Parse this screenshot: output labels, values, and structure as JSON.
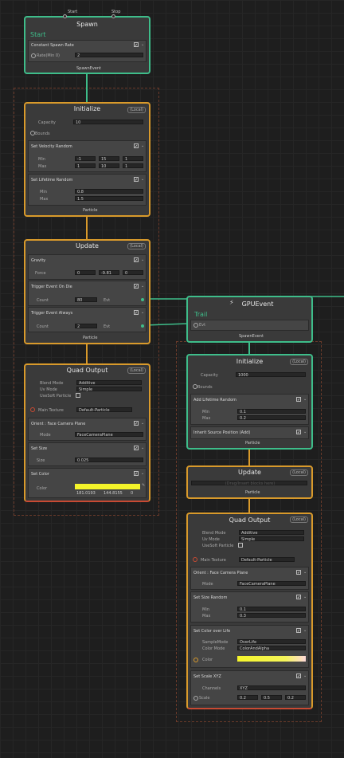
{
  "spawn": {
    "title": "Spawn",
    "start": "Start",
    "stop": "Stop",
    "sub": "Start",
    "block": "Constant Spawn Rate",
    "rate_label": "Rate(Min 0)",
    "rate": "2",
    "out": "SpawnEvent"
  },
  "init1": {
    "title": "Initialize",
    "tag": "(Local)",
    "capacity_label": "Capacity",
    "capacity": "10",
    "bounds": "Bounds",
    "vel_block": "Set Velocity Random",
    "min": "Min",
    "max": "Max",
    "vmin": [
      "-1",
      "15",
      "1"
    ],
    "vmax": [
      "1",
      "10",
      "1"
    ],
    "life_block": "Set Lifetime Random",
    "lmin": "0.8",
    "lmax": "1.5",
    "out": "Particle"
  },
  "update1": {
    "title": "Update",
    "tag": "(Local)",
    "gravity": "Gravity",
    "force": "Force",
    "f": [
      "0",
      "-9.81",
      "0"
    ],
    "trig1": "Trigger Event On Die",
    "count": "Count",
    "c1": "80",
    "evt": "Evt",
    "trig2": "Trigger Event Always",
    "c2": "2",
    "out": "Particle"
  },
  "quad1": {
    "title": "Quad Output",
    "tag": "(Local)",
    "blend": "Blend Mode",
    "blend_v": "Additive",
    "uv": "Uv Mode",
    "uv_v": "Simple",
    "soft": "UseSoft Particle",
    "tex": "Main Texture",
    "tex_v": "Default-Particle",
    "orient": "Orient : Face Camera Plane",
    "mode": "Mode",
    "mode_v": "FaceCameraPlane",
    "size_block": "Set Size",
    "size": "Size",
    "size_v": "0.025",
    "color_block": "Set Color",
    "color": "Color",
    "color_v": [
      "181.0193",
      "144.8155",
      "0"
    ]
  },
  "gpu": {
    "title": "GPUEvent",
    "sub": "Trail",
    "evt": "Evt",
    "out": "SpawnEvent"
  },
  "init2": {
    "title": "Initialize",
    "tag": "(Local)",
    "capacity_label": "Capacity",
    "capacity": "1000",
    "bounds": "Bounds",
    "life_block": "Add Lifetime Random",
    "min": "Min",
    "max": "Max",
    "lmin": "0.1",
    "lmax": "0.2",
    "inherit": "Inherit Source Position (Add)",
    "out": "Particle"
  },
  "update2": {
    "title": "Update",
    "tag": "(Local)",
    "empty": "(Drag/Insert blocks here)",
    "out": "Particle"
  },
  "quad2": {
    "title": "Quad Output",
    "tag": "(Local)",
    "blend": "Blend Mode",
    "blend_v": "Additive",
    "uv": "Uv Mode",
    "uv_v": "Simple",
    "soft": "UseSoft Particle",
    "tex": "Main Texture",
    "tex_v": "Default-Particle",
    "orient": "Orient : Face Camera Plane",
    "mode": "Mode",
    "mode_v": "FaceCameraPlane",
    "sizer": "Set Size Random",
    "min": "Min",
    "max": "Max",
    "smin": "0.1",
    "smax": "0.3",
    "col_block": "Set Color over Life",
    "sample": "SampleMode",
    "sample_v": "OverLife",
    "cmode": "Color Mode",
    "cmode_v": "ColorAndAlpha",
    "color": "Color",
    "scale_block": "Set Scale XYZ",
    "channels": "Channels",
    "channels_v": "XYZ",
    "scale": "Scale",
    "sc": [
      "0.2",
      "0.5",
      "0.2"
    ]
  },
  "colors": {
    "flow": "#d99a2b",
    "event": "#3ebd8a",
    "gradient_yellow": "#f5f55a"
  }
}
